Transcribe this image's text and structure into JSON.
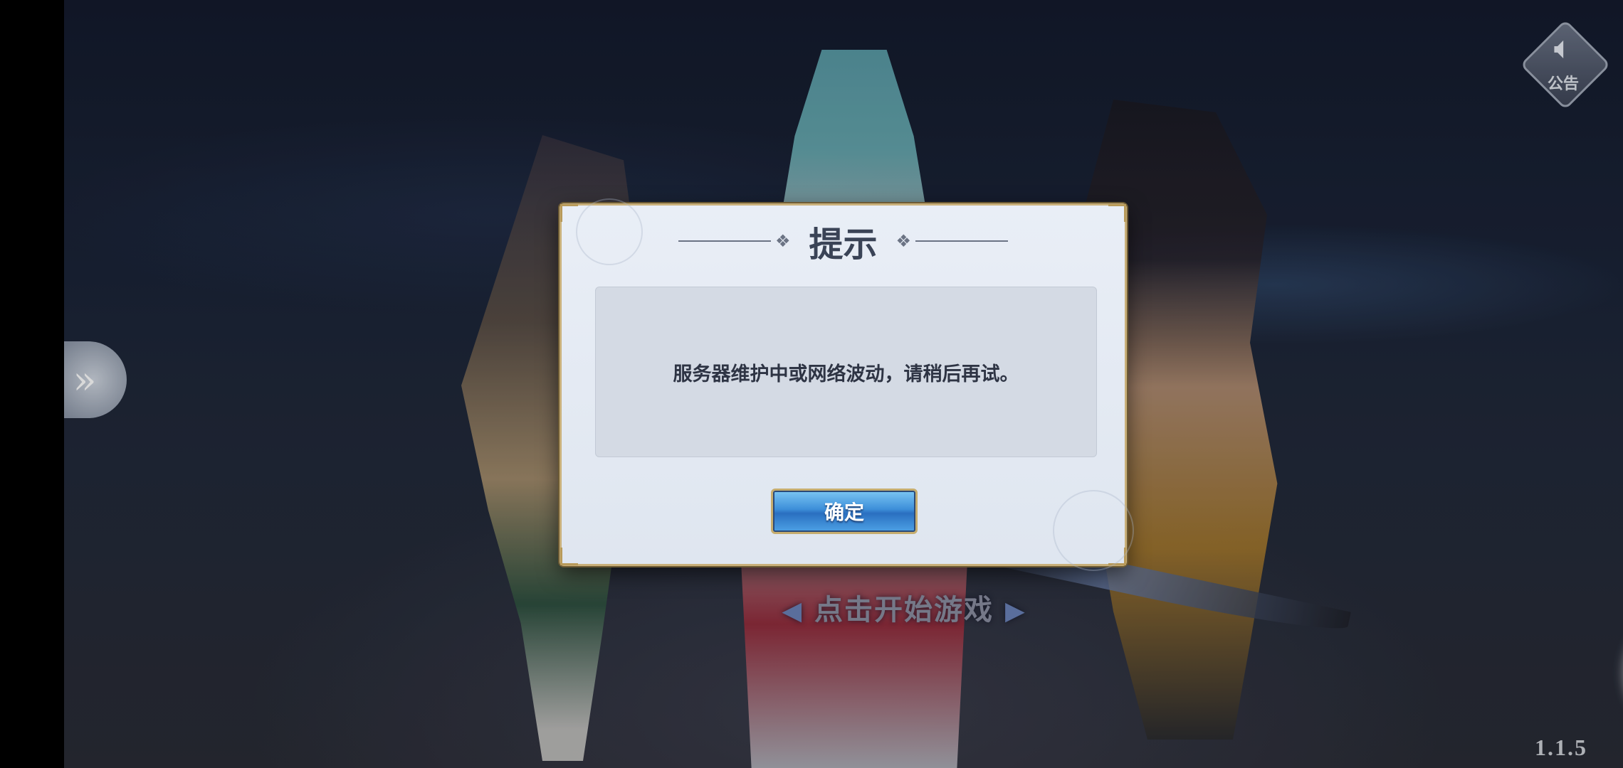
{
  "game": {
    "notice_button": {
      "icon": "speaker-icon",
      "label": "公告"
    },
    "side_button": {
      "icon": "chevron-right-icon"
    },
    "start_prompt": "点击开始游戏",
    "version": "1.1.5"
  },
  "dialog": {
    "title": "提示",
    "message": "服务器维护中或网络波动，请稍后再试。",
    "confirm_label": "确定"
  },
  "colors": {
    "dialog_bg": "#e9eef6",
    "dialog_border": "#c9b07a",
    "button_blue": "#3d8fd9"
  }
}
